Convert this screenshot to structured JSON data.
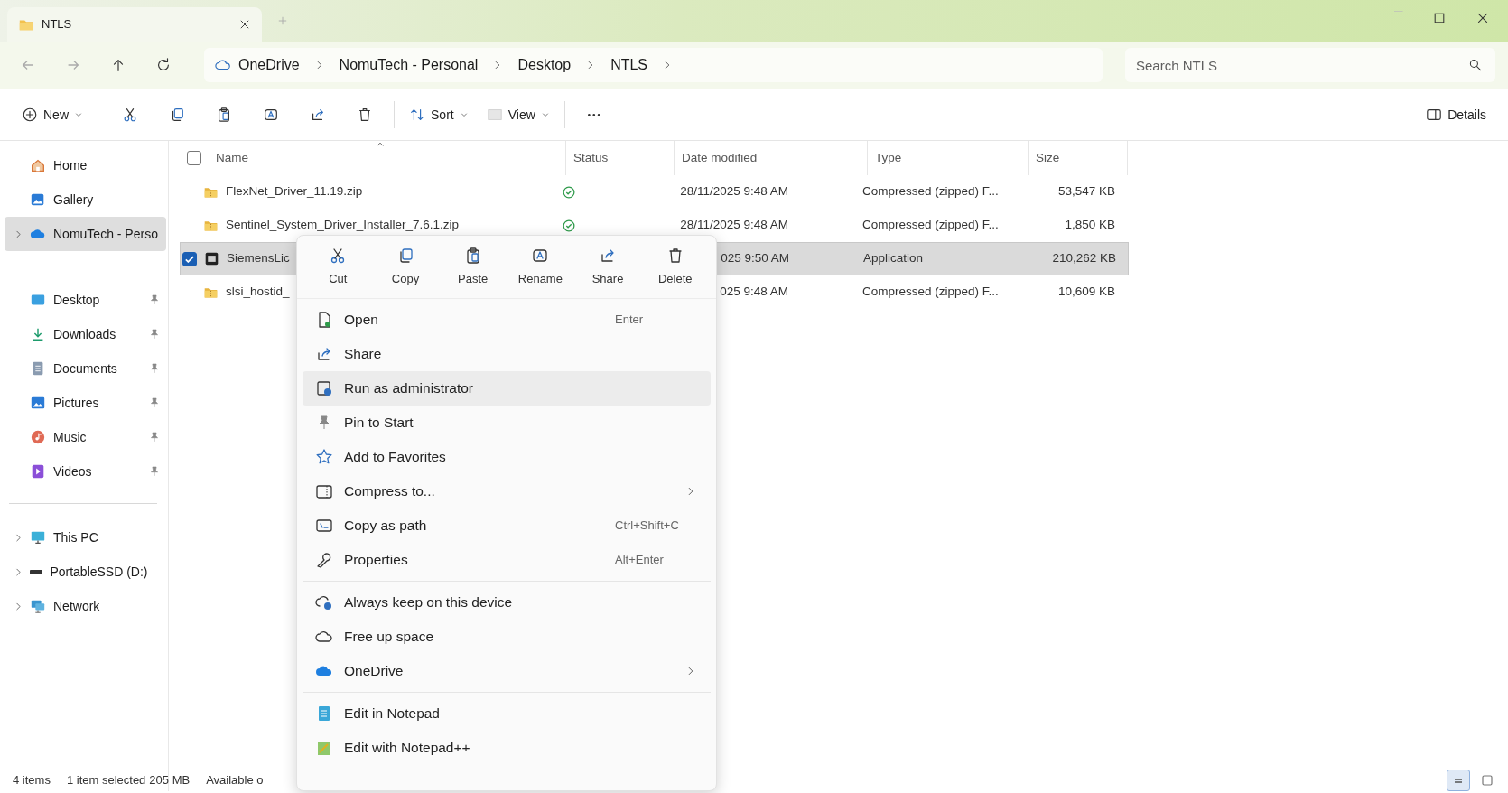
{
  "window": {
    "tab_title": "NTLS"
  },
  "address": {
    "crumbs": [
      "OneDrive",
      "NomuTech - Personal",
      "Desktop",
      "NTLS"
    ]
  },
  "search": {
    "placeholder": "Search NTLS"
  },
  "toolbar": {
    "items": [
      {
        "kind": "new",
        "label": "New"
      },
      {
        "kind": "cut"
      },
      {
        "kind": "copy"
      },
      {
        "kind": "paste"
      },
      {
        "kind": "rename"
      },
      {
        "kind": "share"
      },
      {
        "kind": "delete"
      },
      {
        "kind": "sort",
        "label": "Sort"
      },
      {
        "kind": "view",
        "label": "View"
      },
      {
        "kind": "more"
      }
    ],
    "details": "Details"
  },
  "sidebar": {
    "groups": [
      [
        {
          "kind": "home",
          "label": "Home",
          "expandable": false,
          "pinned": false,
          "selected": false
        },
        {
          "kind": "gallery",
          "label": "Gallery",
          "expandable": false,
          "pinned": false,
          "selected": false
        },
        {
          "kind": "cloud",
          "label": "NomuTech - Perso",
          "expandable": true,
          "pinned": false,
          "selected": true
        }
      ],
      [
        {
          "kind": "desktop",
          "label": "Desktop",
          "expandable": false,
          "pinned": true,
          "selected": false
        },
        {
          "kind": "downloads",
          "label": "Downloads",
          "expandable": false,
          "pinned": true,
          "selected": false
        },
        {
          "kind": "documents",
          "label": "Documents",
          "expandable": false,
          "pinned": true,
          "selected": false
        },
        {
          "kind": "pictures",
          "label": "Pictures",
          "expandable": false,
          "pinned": true,
          "selected": false
        },
        {
          "kind": "music",
          "label": "Music",
          "expandable": false,
          "pinned": true,
          "selected": false
        },
        {
          "kind": "videos",
          "label": "Videos",
          "expandable": false,
          "pinned": true,
          "selected": false
        }
      ],
      [
        {
          "kind": "pc",
          "label": "This PC",
          "expandable": true,
          "pinned": false,
          "selected": false
        },
        {
          "kind": "drive",
          "label": "PortableSSD (D:)",
          "expandable": true,
          "pinned": false,
          "selected": false
        },
        {
          "kind": "network",
          "label": "Network",
          "expandable": true,
          "pinned": false,
          "selected": false
        }
      ]
    ]
  },
  "table": {
    "select_all": {
      "checked": false
    },
    "columns": [
      "Name",
      "Status",
      "Date modified",
      "Type",
      "Size"
    ],
    "rows": [
      {
        "kind": "zip",
        "name": "FlexNet_Driver_11.19.zip",
        "synced": true,
        "date": "28/11/2025 9:48 AM",
        "type": "Compressed (zipped) F...",
        "size": "53,547 KB",
        "selected": false
      },
      {
        "kind": "zip",
        "name": "Sentinel_System_Driver_Installer_7.6.1.zip",
        "synced": true,
        "date": "28/11/2025 9:48 AM",
        "type": "Compressed (zipped) F...",
        "size": "1,850 KB",
        "selected": false
      },
      {
        "kind": "app",
        "name": "SiemensLic",
        "synced": false,
        "date": "025 9:50 AM",
        "type": "Application",
        "size": "210,262 KB",
        "selected": true
      },
      {
        "kind": "zip",
        "name": "slsi_hostid_",
        "synced": false,
        "date": "025 9:48 AM",
        "type": "Compressed (zipped) F...",
        "size": "10,609 KB",
        "selected": false
      }
    ]
  },
  "context_menu": {
    "quick_actions": [
      {
        "kind": "cut",
        "label": "Cut"
      },
      {
        "kind": "copy",
        "label": "Copy"
      },
      {
        "kind": "paste",
        "label": "Paste"
      },
      {
        "kind": "rename",
        "label": "Rename"
      },
      {
        "kind": "share",
        "label": "Share"
      },
      {
        "kind": "delete",
        "label": "Delete"
      }
    ],
    "groups": [
      [
        {
          "kind": "open",
          "label": "Open",
          "shortcut": "Enter",
          "submenu": false,
          "highlighted": false
        },
        {
          "kind": "share",
          "label": "Share",
          "submenu": false,
          "highlighted": false
        },
        {
          "kind": "admin",
          "label": "Run as administrator",
          "submenu": false,
          "highlighted": true
        },
        {
          "kind": "pin",
          "label": "Pin to Start",
          "submenu": false,
          "highlighted": false
        },
        {
          "kind": "star",
          "label": "Add to Favorites",
          "submenu": false,
          "highlighted": false
        },
        {
          "kind": "compress",
          "label": "Compress to...",
          "submenu": true,
          "highlighted": false
        },
        {
          "kind": "path",
          "label": "Copy as path",
          "shortcut": "Ctrl+Shift+C",
          "submenu": false,
          "highlighted": false
        },
        {
          "kind": "wrench",
          "label": "Properties",
          "shortcut": "Alt+Enter",
          "submenu": false,
          "highlighted": false
        }
      ],
      [
        {
          "kind": "keep",
          "label": "Always keep on this device",
          "submenu": false,
          "highlighted": false
        },
        {
          "kind": "freeup",
          "label": "Free up space",
          "submenu": false,
          "highlighted": false
        },
        {
          "kind": "cloud",
          "label": "OneDrive",
          "submenu": true,
          "highlighted": false
        }
      ],
      [
        {
          "kind": "notepad",
          "label": "Edit in Notepad",
          "submenu": false,
          "highlighted": false
        },
        {
          "kind": "notepadpp",
          "label": "Edit with Notepad++",
          "submenu": false,
          "highlighted": false
        }
      ]
    ]
  },
  "status_bar": {
    "texts": [
      "4 items",
      "1 item selected",
      "205 MB",
      "Available o"
    ]
  },
  "view_switch": [
    {
      "kind": "details",
      "selected": true
    },
    {
      "kind": "tiles",
      "selected": false
    }
  ]
}
